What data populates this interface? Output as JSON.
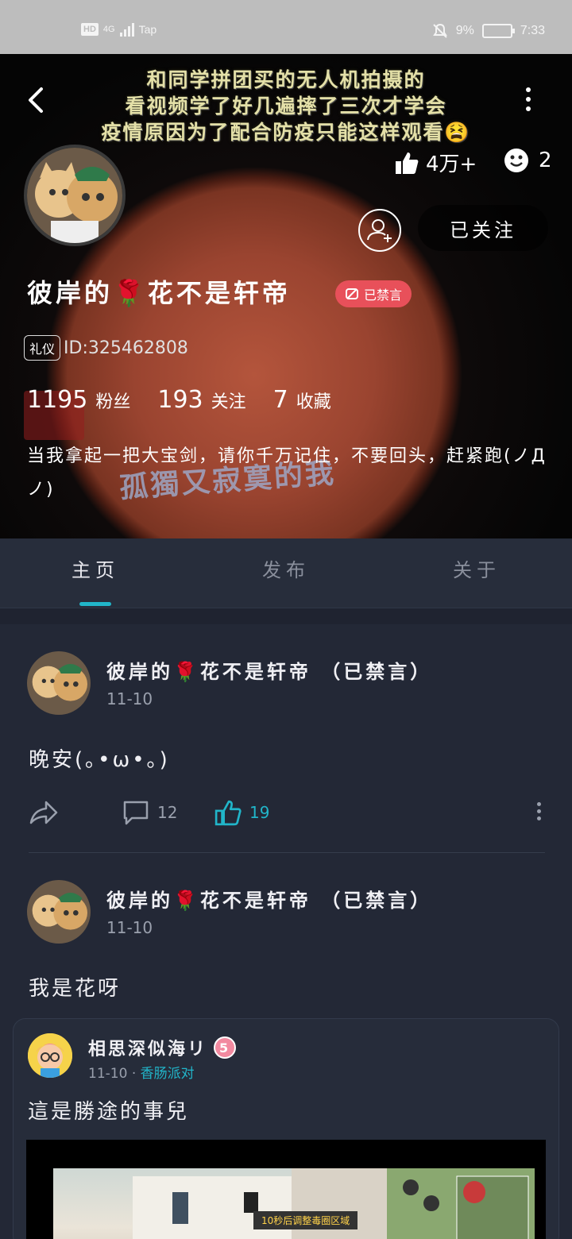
{
  "status_bar": {
    "left_network": "HD",
    "signal_label": "4G",
    "carrier_app": "Tap",
    "battery": "9%",
    "time": "7:33"
  },
  "header": {
    "cover_captions": [
      "和同学拼团买的无人机拍摄的",
      "看视频学了好几遍摔了三次才学会",
      "疫情原因为了配合防疫只能这样观看😫"
    ],
    "cover_bottom_text": "孤獨又寂寞的我",
    "likes": "4万+",
    "reactions": "2",
    "follow_label": "已关注",
    "username": "彼岸的🌹花不是轩帝",
    "muted_badge": "已禁言",
    "etiquette_tag": "礼仪",
    "user_id": "ID:325462808",
    "stats": {
      "fans_num": "1195",
      "fans_label": "粉丝",
      "following_num": "193",
      "following_label": "关注",
      "fav_num": "7",
      "fav_label": "收藏"
    },
    "bio": "当我拿起一把大宝剑，请你千万记住，不要回头，赶紧跑(ノДノ)"
  },
  "tabs": [
    {
      "label": "主页",
      "active": true
    },
    {
      "label": "发布",
      "active": false
    },
    {
      "label": "关于",
      "active": false
    }
  ],
  "posts": [
    {
      "author": "彼岸的🌹花不是轩帝 （已禁言）",
      "date": "11-10",
      "text": "晚安(｡•ω•｡)",
      "comments": "12",
      "likes": "19"
    },
    {
      "author": "彼岸的🌹花不是轩帝 （已禁言）",
      "date": "11-10",
      "text": "我是花呀"
    }
  ],
  "repost": {
    "author": "相思深似海リ",
    "level": "5",
    "date": "11-10",
    "separator": "·",
    "group": "香肠派对",
    "text": "這是勝途的事兒",
    "game_banner": "10秒后调整毒圈区域"
  },
  "colors": {
    "accent": "#21b5c9",
    "badge": "#e8505a",
    "page_bg": "#232836"
  }
}
